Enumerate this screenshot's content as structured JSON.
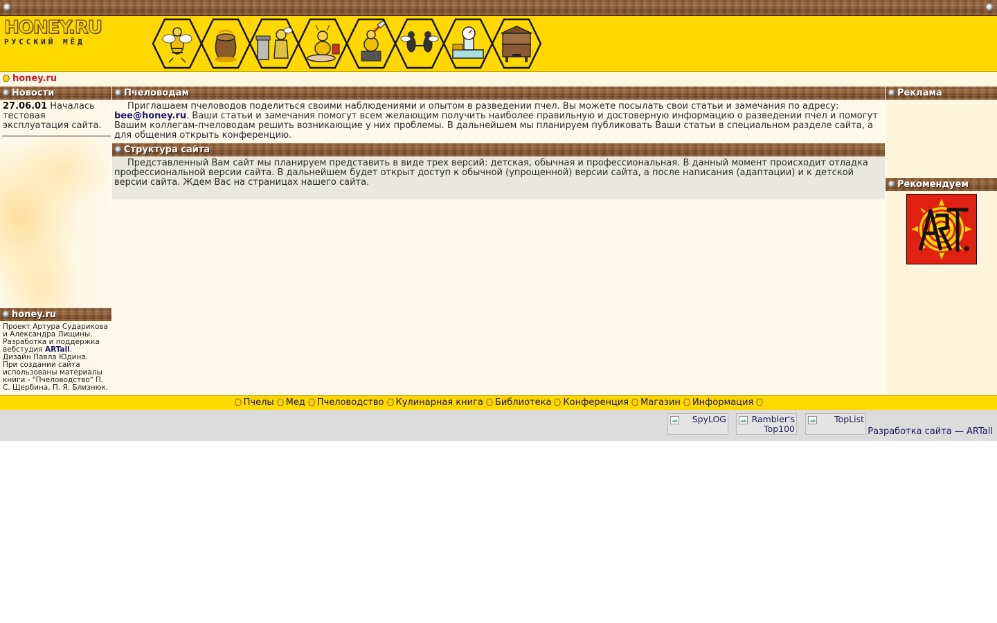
{
  "site": {
    "logo_text": "HONEY.RU",
    "logo_subtitle": "РУССКИЙ МЁД",
    "breadcrumb": "honey.ru"
  },
  "header_icons": [
    {
      "name": "bee-icon"
    },
    {
      "name": "honey-pot-icon"
    },
    {
      "name": "beekeeper-icon"
    },
    {
      "name": "bee-chef-icon"
    },
    {
      "name": "bee-reader-icon"
    },
    {
      "name": "bees-conference-icon"
    },
    {
      "name": "scale-shop-icon"
    },
    {
      "name": "beehive-icon"
    }
  ],
  "left": {
    "news_title": "Новости",
    "news_date": "27.06.01",
    "news_text": " Началась тестовая эксплуатация сайта.",
    "credits_title": "honey.ru",
    "credits_line1": "Проект Артура Сударикова и Александра Лищины.",
    "credits_line2_pre": "Разработка и поддержка вебстудия ",
    "credits_link": "ARTall",
    "credits_line2_post": ".",
    "credits_line3": "Дизайн Павла Юдина.",
    "credits_line4": "При создании сайта использованы материалы книги - \"Пчеловодство\" П. С. Щербина, П. Я. Близнюк."
  },
  "center": {
    "sec1_title": "Пчеловодам",
    "sec1_text_pre": "Приглашаем пчеловодов поделиться своими наблюдениями и опытом в разведении пчел. Вы можете посылать свои статьи и замечания по адресу: ",
    "sec1_email": "bee@honey.ru",
    "sec1_text_post": ". Ваши статьи и замечания помогут всем желающим получить наиболее правильную и достоверную информацию о разведении пчел и помогут Вашим коллегам-пчеловодам решить возникающие у них проблемы. В дальнейшем мы планируем публиковать Ваши статьи в специальном разделе сайта, а для общения открыть конференцию.",
    "sec2_title": "Структура сайта",
    "sec2_text": "Представленный Вам сайт мы планируем представить в виде трех версий: детская, обычная и профессиональная. В данный момент происходит отладка профессиональной версии сайта. В дальнейшем будет открыт доступ к обычной (упрощенной) версии сайта, а после написания (адаптации) и к детской версии сайта. Ждем Вас на страницах нашего сайта."
  },
  "right": {
    "ad_title": "Реклама",
    "recommend_title": "Рекомендуем",
    "recommend_logo": "ARTall"
  },
  "menu": [
    "Пчелы",
    "Мед",
    "Пчеловодство",
    "Кулинарная книга",
    "Библиотека",
    "Конференция",
    "Магазин",
    "Информация"
  ],
  "footer": {
    "counters": [
      "SpyLOG",
      "Rambler's Top100",
      "TopList"
    ],
    "dev_credit": "Разработка сайта — ARTall"
  },
  "colors": {
    "header_yellow": "#ffd800",
    "wood_brown": "#8a5a35",
    "link_red": "#c81a2a",
    "link_navy": "#1a1a6a"
  }
}
